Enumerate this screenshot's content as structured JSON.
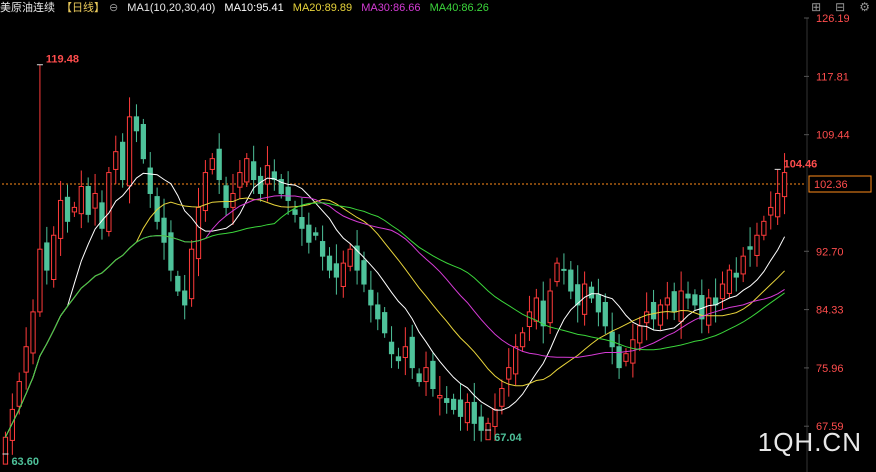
{
  "header": {
    "title": "美原油连续",
    "period": "【日线】",
    "lock_icon": "lock-icon",
    "ma_title": "MA1(10,20,30,40)",
    "ma10": "MA10:95.41",
    "ma20": "MA20:89.89",
    "ma30": "MA30:86.66",
    "ma40": "MA40:86.26"
  },
  "toolbar": {
    "zoom_in_icon": "zoom-in-icon",
    "zoom_out_icon": "zoom-out-icon",
    "settings_icon": "settings-icon"
  },
  "watermark": "1QH.CN",
  "colors": {
    "up": "#ff3b3b",
    "down": "#4ec29a",
    "ma10": "#ffffff",
    "ma20": "#e8d43b",
    "ma30": "#d63bd6",
    "ma40": "#3bd63b",
    "current_price_line": "#ff8c1a",
    "axis_label": "#ff4d4d"
  },
  "chart_data": {
    "type": "candlestick",
    "ylim": [
      63.6,
      126.19
    ],
    "y_ticks": [
      "126.19",
      "117.81",
      "109.44",
      "102.36",
      "92.70",
      "84.33",
      "75.96",
      "67.59"
    ],
    "current_price": 102.36,
    "current_price_label": "102.36",
    "annotations": [
      {
        "label": "119.48",
        "value": 119.48,
        "index": 5
      },
      {
        "label": "104.46",
        "value": 104.46,
        "index": 112
      },
      {
        "label": "67.04",
        "value": 67.04,
        "index": 70
      },
      {
        "label": "63.60",
        "value": 63.6,
        "index": 0
      }
    ],
    "closes": [
      66,
      70,
      74,
      79,
      84,
      93,
      90,
      95,
      100,
      97,
      99,
      102,
      98,
      101,
      96,
      104,
      107,
      103,
      112,
      110,
      106,
      101,
      97,
      94,
      90,
      87,
      85,
      93,
      99,
      104,
      106,
      103,
      99,
      101,
      104,
      106,
      103,
      101,
      105,
      103,
      101,
      100,
      98,
      96,
      94,
      95,
      92,
      90,
      89,
      91,
      93,
      90,
      88,
      85,
      83,
      81,
      78,
      77,
      79,
      76,
      74,
      76,
      73,
      72,
      71,
      70,
      69,
      71,
      68,
      67,
      68,
      70,
      73,
      76,
      79,
      81,
      84,
      86,
      82,
      87,
      91,
      90,
      87,
      85,
      88,
      86,
      84,
      82,
      79,
      76,
      78,
      80,
      82,
      84,
      83,
      85,
      86,
      84,
      87,
      86,
      85,
      83,
      86,
      85,
      88,
      90,
      89,
      92,
      93,
      95,
      97,
      99,
      101,
      104
    ],
    "ma_series": [
      {
        "name": "MA10",
        "period": 10
      },
      {
        "name": "MA20",
        "period": 20
      },
      {
        "name": "MA30",
        "period": 30
      },
      {
        "name": "MA40",
        "period": 40
      }
    ]
  }
}
